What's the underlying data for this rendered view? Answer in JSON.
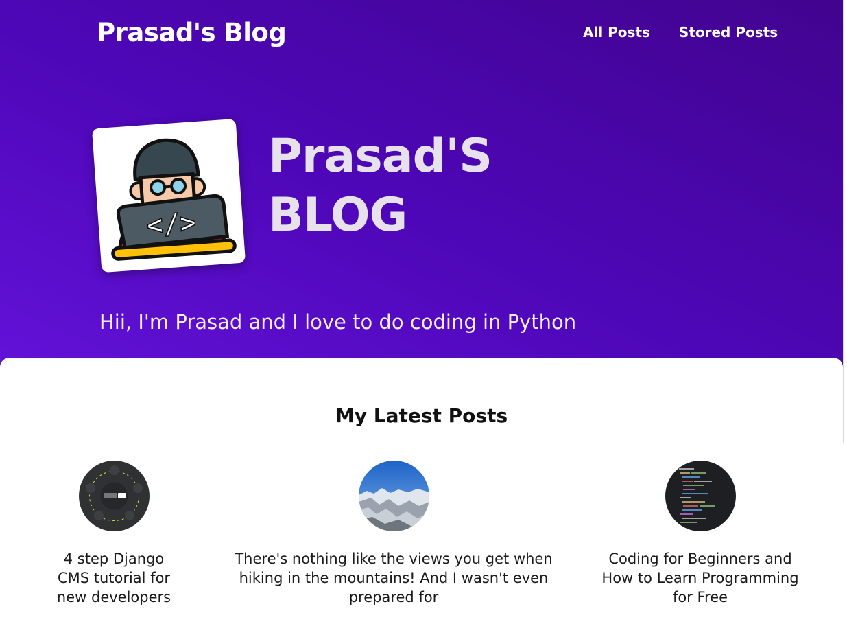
{
  "header": {
    "site_title": "Prasad's Blog",
    "nav": [
      {
        "label": "All Posts"
      },
      {
        "label": "Stored Posts"
      }
    ]
  },
  "hero": {
    "title_line1": "Prasad'S",
    "title_line2": "BLOG",
    "tagline": "Hii, I'm Prasad and I love to do coding in Python",
    "avatar_icon": "developer-avatar-icon"
  },
  "latest": {
    "heading": "My Latest Posts",
    "posts": [
      {
        "title": "4 step Django CMS tutorial for new developers",
        "thumb_icon": "django-cms-thumbnail"
      },
      {
        "title": "There's nothing like the views you get when hiking in the mountains! And I wasn't even prepared for",
        "thumb_icon": "mountain-photo-thumbnail"
      },
      {
        "title": "Coding for Beginners and How to Learn Programming for Free",
        "thumb_icon": "code-editor-thumbnail"
      }
    ]
  },
  "colors": {
    "hero_start": "#6312d8",
    "hero_end": "#42038f",
    "hero_title": "#e6e1ec",
    "text_dark": "#111111"
  }
}
